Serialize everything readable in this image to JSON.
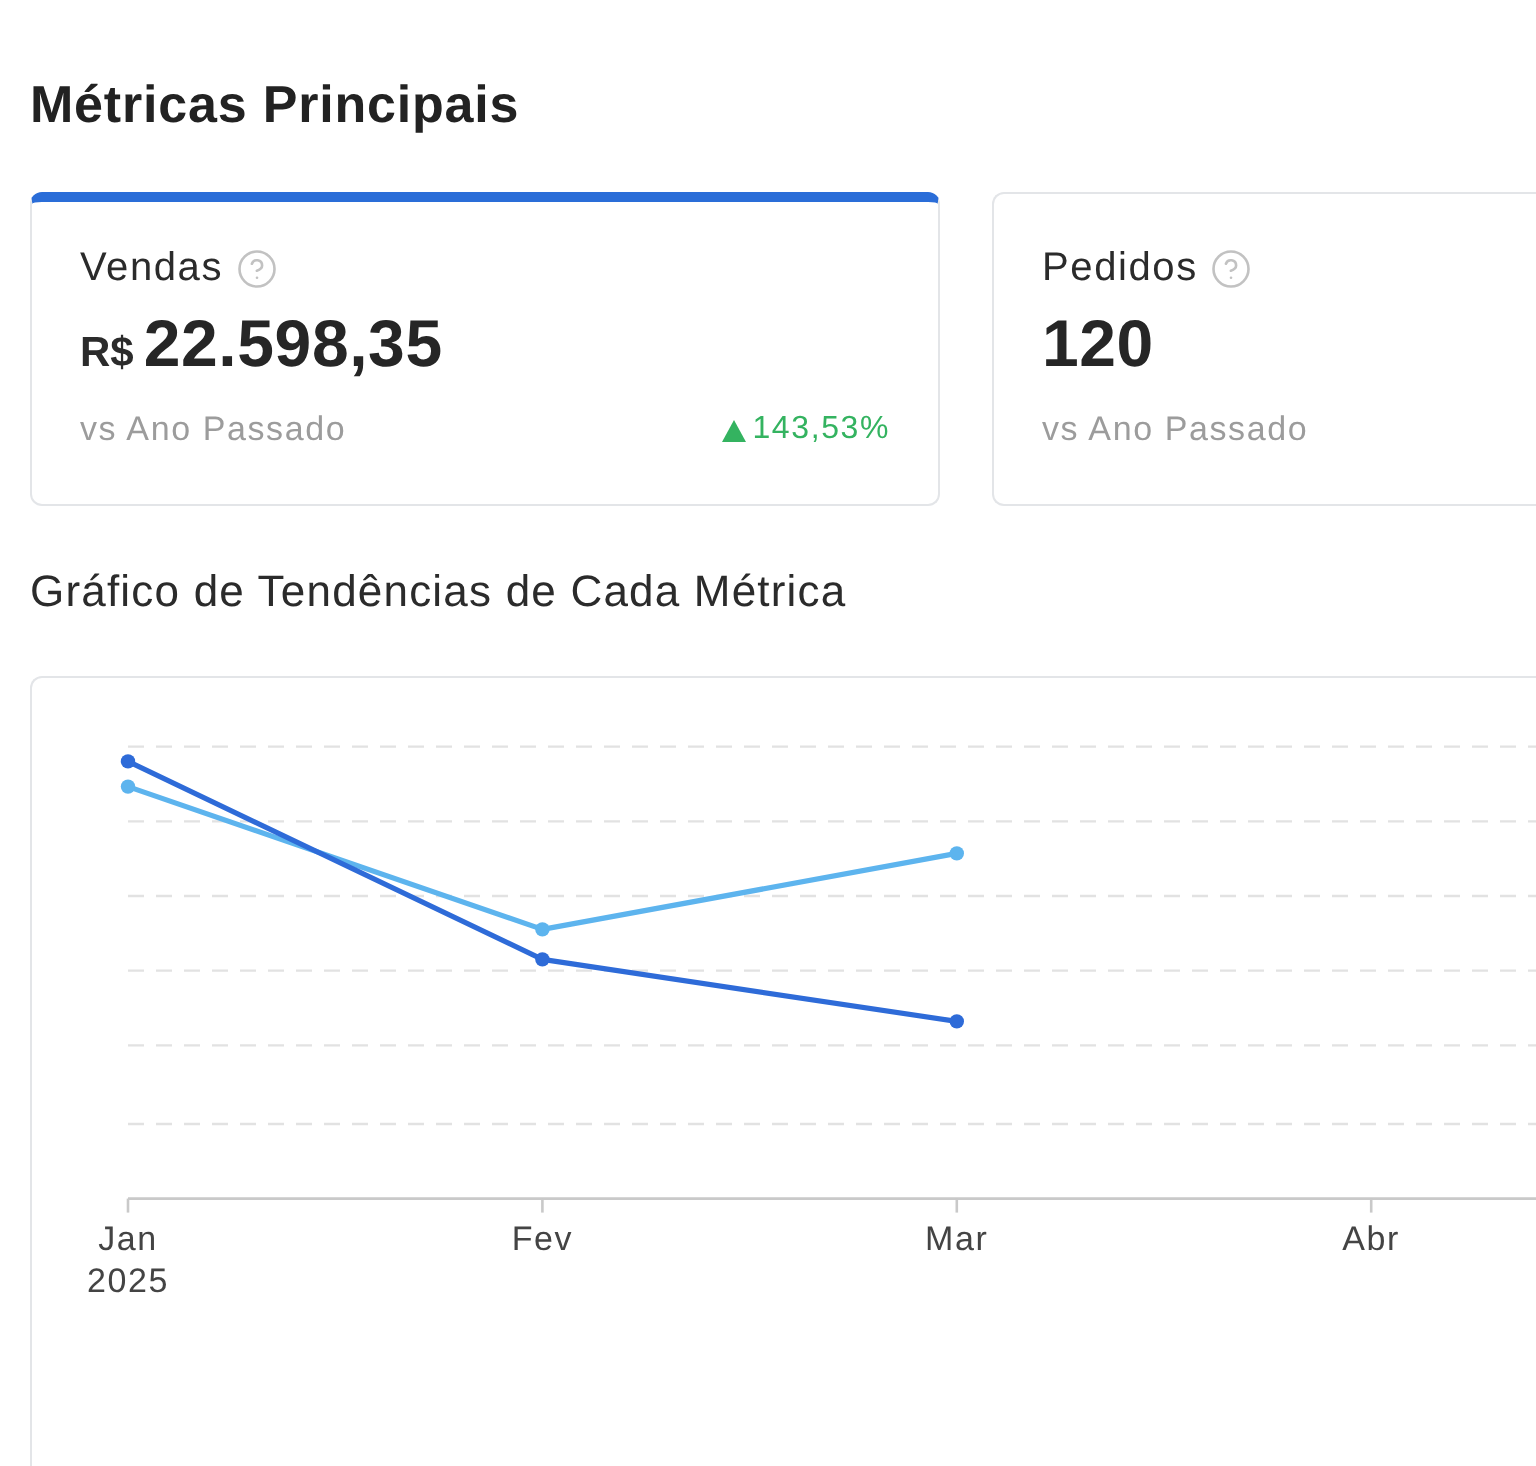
{
  "heading": "Métricas Principais",
  "metric_cards": [
    {
      "label": "Vendas",
      "currency": "R$",
      "value": "22.598,35",
      "comparison": "vs Ano Passado",
      "change": "143,53%",
      "positive": true,
      "selected": true
    },
    {
      "label": "Pedidos",
      "value": "120",
      "comparison": "vs Ano Passado",
      "selected": false
    }
  ],
  "chart_section": {
    "title": "Gráfico de Tendências de Cada Métrica",
    "x_axis_labels": [
      {
        "label": "Jan",
        "year": "2025"
      },
      {
        "label": "Fev"
      },
      {
        "label": "Mar"
      },
      {
        "label": "Abr"
      }
    ]
  }
}
